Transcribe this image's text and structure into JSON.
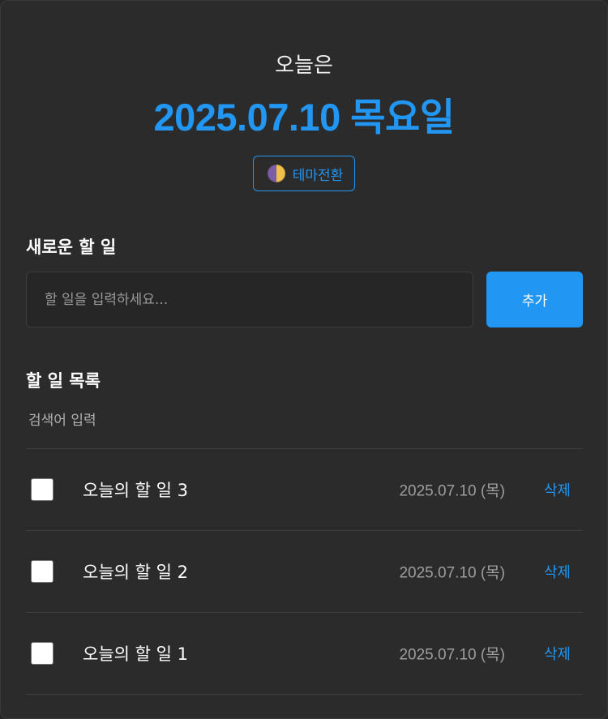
{
  "header": {
    "today_label": "오늘은",
    "date_title": "2025.07.10 목요일",
    "theme_button_label": "테마전환",
    "theme_icon": "half-moon-icon"
  },
  "new_todo": {
    "section_title": "새로운 할 일",
    "input_placeholder": "할 일을 입력하세요...",
    "input_value": "",
    "add_button_label": "추가"
  },
  "todo_list": {
    "section_title": "할 일 목록",
    "search_placeholder": "검색어 입력",
    "search_value": "",
    "items": [
      {
        "text": "오늘의 할 일 3",
        "date": "2025.07.10 (목)",
        "delete_label": "삭제",
        "checked": false
      },
      {
        "text": "오늘의 할 일 2",
        "date": "2025.07.10 (목)",
        "delete_label": "삭제",
        "checked": false
      },
      {
        "text": "오늘의 할 일 1",
        "date": "2025.07.10 (목)",
        "delete_label": "삭제",
        "checked": false
      }
    ]
  },
  "colors": {
    "accent": "#2196f3",
    "background": "#2b2b2b",
    "muted_text": "#9e9e9e"
  }
}
